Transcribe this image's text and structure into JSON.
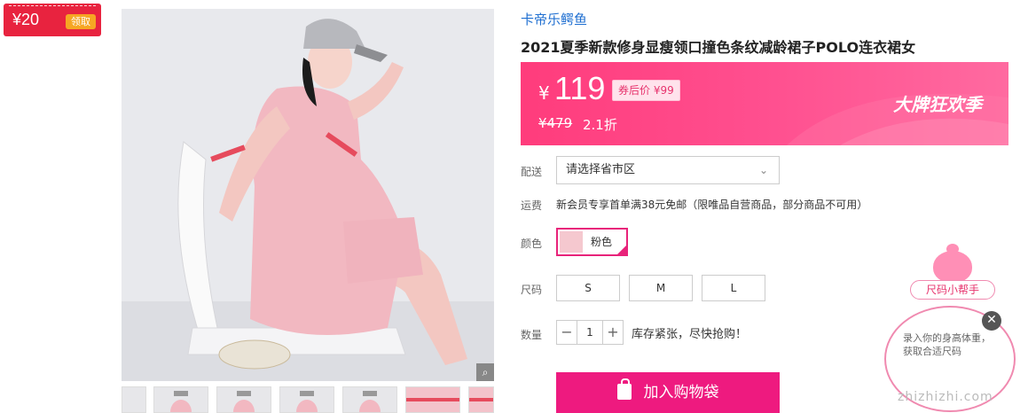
{
  "coupon": {
    "amount": "¥20",
    "claim_label": "领取"
  },
  "gallery": {
    "zoom_icon": "magnifier-icon",
    "thumbnail_count": 7
  },
  "product": {
    "brand": "卡帝乐鳄鱼",
    "title": "2021夏季新款修身显瘦领口撞色条纹减龄裙子POLO连衣裙女"
  },
  "price": {
    "currency": "¥",
    "current": "119",
    "after_coupon": "券后价 ¥99",
    "original": "¥479",
    "discount": "2.1折",
    "promo": "大牌狂欢季"
  },
  "labels": {
    "delivery": "配送",
    "shipping": "运费",
    "color": "颜色",
    "size": "尺码",
    "quantity": "数量"
  },
  "delivery": {
    "placeholder": "请选择省市区"
  },
  "shipping_text": "新会员专享首单满38元免邮（限唯品自营商品，部分商品不可用）",
  "color_options": [
    {
      "label": "粉色",
      "selected": true
    }
  ],
  "sizes": [
    "S",
    "M",
    "L"
  ],
  "quantity": {
    "minus": "−",
    "value": "1",
    "plus": "+"
  },
  "stock_text": "库存紧张，尽快抢购！",
  "add_to_cart": "加入购物袋",
  "size_helper": {
    "button": "尺码小帮手",
    "bubble": "录入你的身高体重，获取合适尺码"
  },
  "watermark": "zhizhizhi.com",
  "colors": {
    "accent": "#ee1a7f",
    "price_band": "#ff4f8f",
    "brand_link": "#1f6fd1"
  }
}
